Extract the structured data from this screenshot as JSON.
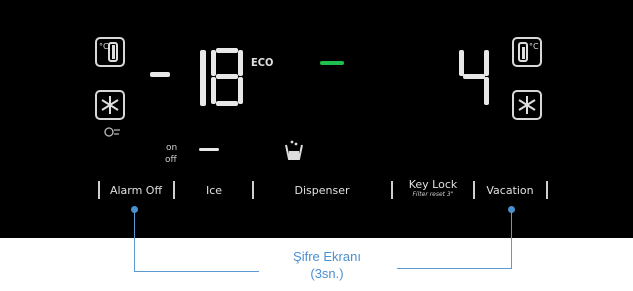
{
  "display": {
    "freezer": {
      "sign": "-",
      "temp": "18",
      "mode": "ECO"
    },
    "fridge": {
      "temp": "4"
    },
    "ice_status": {
      "on": "on",
      "off": "off"
    }
  },
  "buttons": [
    {
      "label": "Alarm Off"
    },
    {
      "label": "Ice"
    },
    {
      "label": "Dispenser"
    },
    {
      "label": "Key Lock",
      "sub": "Filter reset 3\""
    },
    {
      "label": "Vacation"
    }
  ],
  "callout": {
    "line1": "Şifre Ekranı",
    "line2": "(3sn.)"
  },
  "icons": {
    "freezer_temp": "thermometer-celsius-icon",
    "freezer_snow": "snowflake-icon",
    "power_freeze": "power-freeze-icon",
    "fridge_temp": "thermometer-celsius-icon",
    "fridge_snow": "snowflake-icon",
    "dispenser": "water-glass-icon"
  },
  "colors": {
    "panel": "#000000",
    "segment": "#e8e8e8",
    "eco_indicator": "#1fbf4f",
    "callout": "#4a8fd0"
  }
}
